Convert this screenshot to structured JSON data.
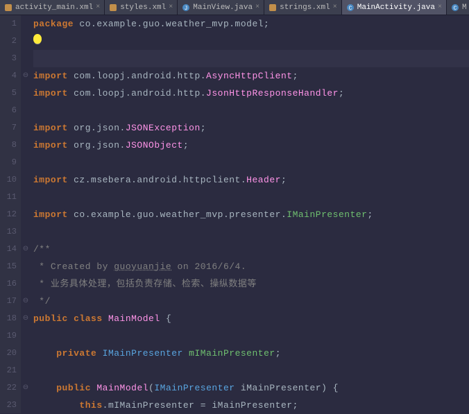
{
  "tabs": [
    {
      "label": "activity_main.xml",
      "icon": "xml",
      "active": false
    },
    {
      "label": "styles.xml",
      "icon": "xml",
      "active": false
    },
    {
      "label": "MainView.java",
      "icon": "java",
      "active": false
    },
    {
      "label": "strings.xml",
      "icon": "xml",
      "active": false
    },
    {
      "label": "MainActivity.java",
      "icon": "c",
      "active": true
    },
    {
      "label": "M",
      "icon": "c",
      "active": false
    }
  ],
  "code": {
    "l1": {
      "kw": "package",
      "rest": " co.example.guo.weather_mvp.model;"
    },
    "l4": {
      "kw": "import",
      "p1": " com.loopj.android.http.",
      "cls": "AsyncHttpClient",
      "semi": ";"
    },
    "l5": {
      "kw": "import",
      "p1": " com.loopj.android.http.",
      "cls": "JsonHttpResponseHandler",
      "semi": ";"
    },
    "l7": {
      "kw": "import",
      "p1": " org.json.",
      "cls": "JSONException",
      "semi": ";"
    },
    "l8": {
      "kw": "import",
      "p1": " org.json.",
      "cls": "JSONObject",
      "semi": ";"
    },
    "l10": {
      "kw": "import",
      "p1": " cz.msebera.android.httpclient.",
      "cls": "Header",
      "semi": ";"
    },
    "l12": {
      "kw": "import",
      "p1": " co.example.guo.weather_mvp.presenter.",
      "cls": "IMainPresenter",
      "semi": ";"
    },
    "l14": "/**",
    "l15a": " * Created by ",
    "l15auth": "guoyuanjie",
    "l15b": " on 2016/6/4.",
    "l16": " * 业务具体处理，包括负责存储、检索、操纵数据等",
    "l17": " */",
    "l18": {
      "kw1": "public",
      "kw2": "class",
      "name": "MainModel",
      "brace": "{"
    },
    "l20": {
      "kw": "private",
      "type": "IMainPresenter",
      "var": "mIMainPresenter",
      ";": ";"
    },
    "l22": {
      "kw": "public",
      "name": "MainModel",
      "paren": "(",
      "type": "IMainPresenter",
      "arg": " iMainPresenter) {"
    },
    "l23": {
      "kw": "this",
      "rest": ".mIMainPresenter = iMainPresenter;"
    }
  },
  "linecount": 23
}
